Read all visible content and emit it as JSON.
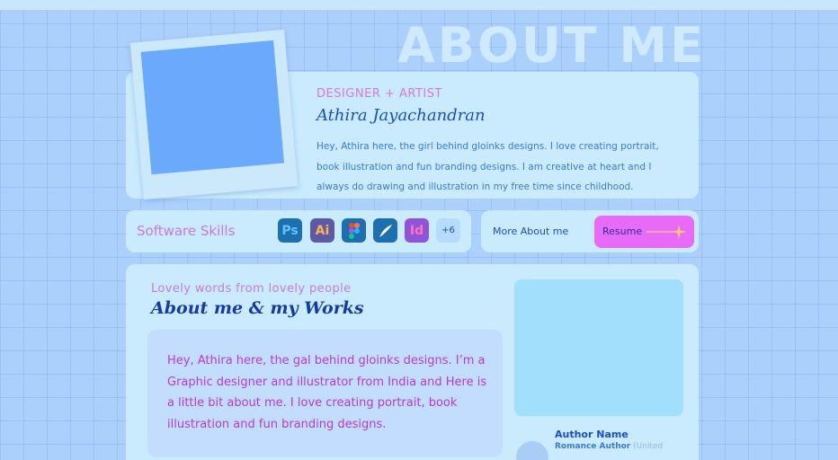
{
  "page": {
    "heading": "ABOUT ME"
  },
  "profile": {
    "role": "DESIGNER + ARTIST",
    "name": "Athira Jayachandran",
    "bio": "Hey, Athira here, the girl behind gloinks designs.  I love creating portrait, book illustration and fun branding designs. I am creative at heart and I always do drawing and illustration in my free time since childhood."
  },
  "skills": {
    "label": "Software Skills",
    "icons": [
      {
        "text": "Ps",
        "icon": "photoshop-icon",
        "bg": "#1d6fb0",
        "fg": "#5ec6ff"
      },
      {
        "text": "Ai",
        "icon": "illustrator-icon",
        "bg": "#5c5aa8",
        "fg": "#ffb24a"
      },
      {
        "text": "",
        "icon": "figma-icon",
        "bg": "#1d6fb0",
        "fg": "#ffffff"
      },
      {
        "text": "",
        "icon": "procreate-icon",
        "bg": "#1d6fb0",
        "fg": "#ffffff"
      },
      {
        "text": "Id",
        "icon": "indesign-icon",
        "bg": "#8f55d6",
        "fg": "#ff6fc8"
      }
    ],
    "more_count": "+6"
  },
  "more_about": {
    "label": "More About me",
    "resume_label": "Resume"
  },
  "works": {
    "subtitle": "Lovely words from lovely people",
    "title": "About me & my Works",
    "quote": "Hey, Athira here, the gal behind gloinks designs. I’m a Graphic designer and illustrator from India and Here is a little bit about me. I love creating portrait, book illustration and fun branding designs.",
    "author": {
      "name": "Author Name",
      "role": "Romance Author",
      "location": "(United"
    }
  },
  "colors": {
    "background": "#abd0fb",
    "card": "#c9ebfd",
    "accent_pink": "#e76bf6",
    "text_blue": "#1a4fc2",
    "text_lilac": "#c779e2"
  }
}
